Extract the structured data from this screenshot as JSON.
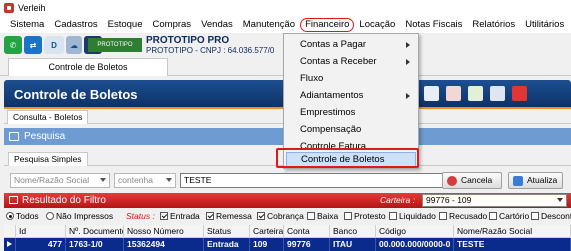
{
  "window": {
    "title": "Verleih"
  },
  "menubar": {
    "items": [
      "Sistema",
      "Cadastros",
      "Estoque",
      "Compras",
      "Vendas",
      "Manutenção",
      "Financeiro",
      "Locação",
      "Notas Fiscais",
      "Relatórios",
      "Utilitários"
    ],
    "active": "Financeiro"
  },
  "company": {
    "logo_text": "PROTOTIPO",
    "name": "PROTOTIPO PRO",
    "cnpj": "PROTOTIPO - CNPJ : 64.036.577/0"
  },
  "main_tab": {
    "label": "Controle de Boletos"
  },
  "page": {
    "title": "Controle de Boletos"
  },
  "subtab": {
    "label": "Consulta - Boletos"
  },
  "pesquisa": {
    "title": "Pesquisa"
  },
  "pesquisa_tabs": {
    "label": "Pesquisa Simples"
  },
  "search": {
    "field_select": "Nome/Razão Social",
    "operator_select": "contenha",
    "value": "TESTE",
    "cancel_label": "Cancela",
    "refresh_label": "Atualiza"
  },
  "results": {
    "title": "Resultado do Filtro",
    "carteira_label": "Carteira :",
    "carteira_value": "99776 - 109"
  },
  "filters": {
    "todos": "Todos",
    "nao_impressos": "Não Impressos",
    "status_label": "Status :",
    "entrada": "Entrada",
    "remessa": "Remessa",
    "cobranca": "Cobrança",
    "baixa": "Baixa",
    "protesto": "Protesto",
    "liquidado": "Liquidado",
    "recusado": "Recusado",
    "cartorio": "Cartório",
    "desconto": "Desconto"
  },
  "grid": {
    "columns": [
      "Id",
      "Nº. Documento",
      "Nosso Número",
      "Status",
      "Carteira",
      "Conta",
      "Banco",
      "Código",
      "Nome/Razão Social"
    ],
    "rows": [
      [
        "477",
        "1763-1/0",
        "15362494",
        "Entrada",
        "109",
        "99776",
        "ITAU",
        "00.000.000/0000-0",
        "TESTE"
      ]
    ]
  },
  "financeiro_menu": {
    "items": [
      {
        "label": "Contas a Pagar",
        "submenu": true
      },
      {
        "label": "Contas a Receber",
        "submenu": true
      },
      {
        "label": "Fluxo",
        "submenu": false
      },
      {
        "label": "Adiantamentos",
        "submenu": true
      },
      {
        "label": "Emprestimos",
        "submenu": false
      },
      {
        "label": "Compensação",
        "submenu": false
      },
      {
        "label": "Controle Fatura",
        "submenu": false
      },
      {
        "label": "Controle de Boletos",
        "submenu": false
      }
    ],
    "selected": "Controle de Boletos"
  },
  "colors": {
    "header_blue": "#0d2f63",
    "results_red": "#c21a1a",
    "selected_row": "#0a2a8c",
    "highlight": "#e01818"
  }
}
